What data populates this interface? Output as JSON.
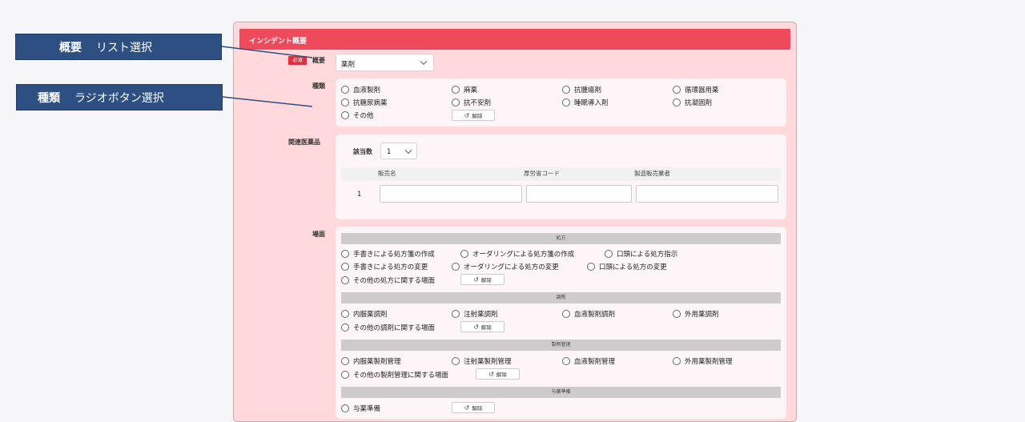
{
  "header": {
    "title": "インシデント概要"
  },
  "callouts": [
    {
      "bold": "概要",
      "text": "リスト選択"
    },
    {
      "bold": "種類",
      "text": "ラジオボタン選択"
    }
  ],
  "summary": {
    "required_badge": "必須",
    "label": "概要",
    "value": "薬剤"
  },
  "kind": {
    "label": "種類",
    "options": [
      "血液製剤",
      "麻薬",
      "抗腫瘍剤",
      "循環器用薬",
      "抗糖尿病薬",
      "抗不安剤",
      "睡眠導入剤",
      "抗凝固剤",
      "その他"
    ],
    "clear_label": "解除"
  },
  "related_drugs": {
    "label": "関連医薬品",
    "count_label": "該当数",
    "count_value": "1",
    "columns": [
      "販売名",
      "厚労省コード",
      "製造販売業者"
    ],
    "rows": [
      {
        "index": "1"
      }
    ]
  },
  "scene": {
    "label": "場面",
    "clear_label": "解除",
    "sections": [
      {
        "title": "処方",
        "options": [
          "手書きによる処方箋の作成",
          "オーダリングによる処方箋の作成",
          "口頭による処方指示",
          "手書きによる処方の変更",
          "オーダリングによる処方の変更",
          "口頭による処方の変更",
          "その他の処方に関する場面"
        ]
      },
      {
        "title": "調剤",
        "options": [
          "内服薬調剤",
          "注射薬調剤",
          "血液製剤調剤",
          "外用薬調剤",
          "その他の調剤に関する場面"
        ]
      },
      {
        "title": "製剤管理",
        "options": [
          "内服薬製剤管理",
          "注射薬製剤管理",
          "血液製剤管理",
          "外用薬製剤管理",
          "その他の製剤管理に関する場面"
        ]
      },
      {
        "title": "与薬準備",
        "options": [
          "与薬準備"
        ]
      }
    ]
  }
}
